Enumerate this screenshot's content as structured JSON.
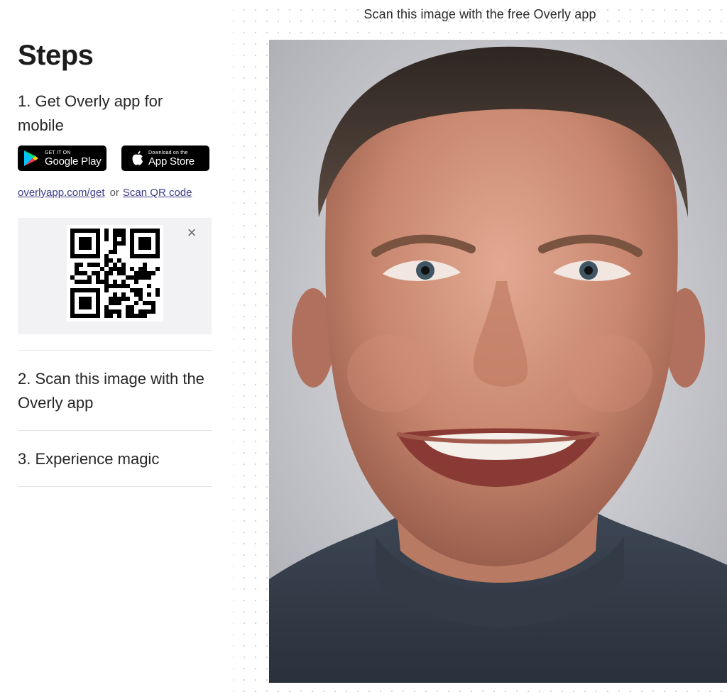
{
  "left_panel": {
    "title": "Steps",
    "step1": {
      "text": "1. Get Overly app for mobile"
    },
    "google_play": {
      "small": "GET IT ON",
      "big": "Google Play",
      "icon": "google-play-icon"
    },
    "app_store": {
      "small": "Download on the",
      "big": "App Store",
      "icon": "apple-icon"
    },
    "links": {
      "get_link": "overlyapp.com/get",
      "or": "or",
      "qr_link": "Scan QR code"
    },
    "qr": {
      "close": "×"
    },
    "step2": {
      "text": "2. Scan this image with the Overly app"
    },
    "step3": {
      "text": "3. Experience magic"
    }
  },
  "canvas": {
    "caption": "Scan this image with the free Overly app"
  },
  "colors": {
    "text": "#1c1c1c",
    "link": "#3b3b8a",
    "qr_panel_bg": "#f2f2f4",
    "store_button_bg": "#000000"
  }
}
